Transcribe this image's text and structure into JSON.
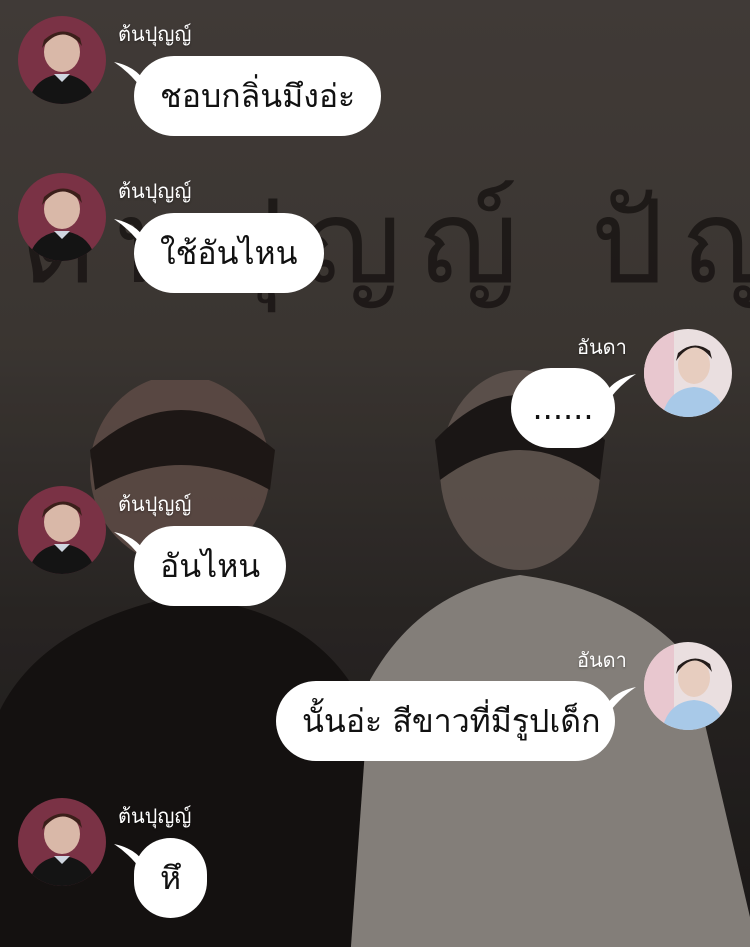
{
  "background": {
    "overlay_text": "ต้นปุญญ์ ปัญญ"
  },
  "participants": {
    "left_name": "ต้นปุญญ์",
    "right_name": "อันดา"
  },
  "messages": [
    {
      "sender": "ต้นปุญญ์",
      "side": "left",
      "text": "ชอบกลิ่นมึงอ่ะ"
    },
    {
      "sender": "ต้นปุญญ์",
      "side": "left",
      "text": "ใช้อันไหน"
    },
    {
      "sender": "อันดา",
      "side": "right",
      "text": "......"
    },
    {
      "sender": "ต้นปุญญ์",
      "side": "left",
      "text": "อันไหน"
    },
    {
      "sender": "อันดา",
      "side": "right",
      "text": "นั้นอ่ะ สีขาวที่มีรูปเด็ก"
    },
    {
      "sender": "ต้นปุญญ์",
      "side": "left",
      "text": "หึ"
    }
  ],
  "colors": {
    "bubble": "#ffffff",
    "bubble_text": "#111111",
    "name_text": "#ffffff",
    "background": "#433e39"
  },
  "icons": {
    "left_avatar": "profile-photo-dark-outfit",
    "right_avatar": "profile-photo-light-outfit"
  }
}
